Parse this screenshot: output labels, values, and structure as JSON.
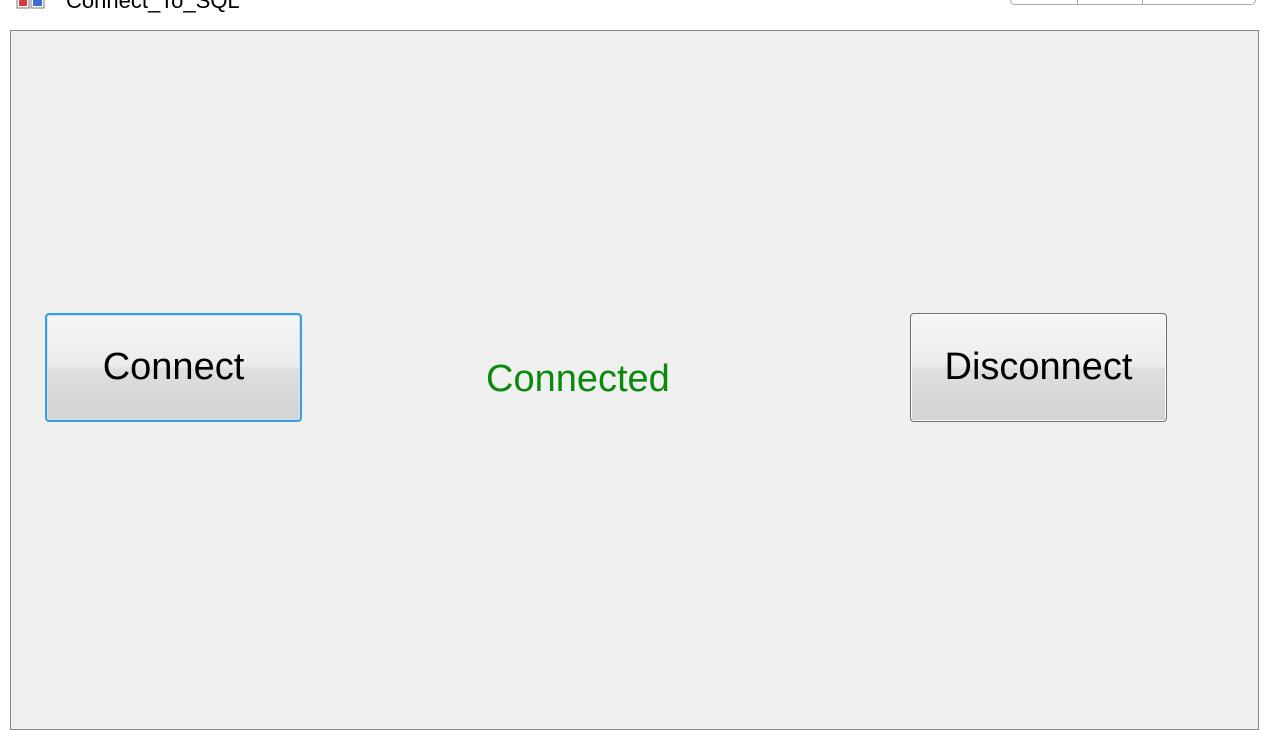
{
  "window": {
    "title": "Connect_To_SQL",
    "icon": "form-icon"
  },
  "buttons": {
    "connect_label": "Connect",
    "disconnect_label": "Disconnect"
  },
  "status": {
    "text": "Connected",
    "color": "#0a8a0a"
  },
  "colors": {
    "focus_border": "#3c9fdd",
    "form_background": "#f0f0f0"
  }
}
